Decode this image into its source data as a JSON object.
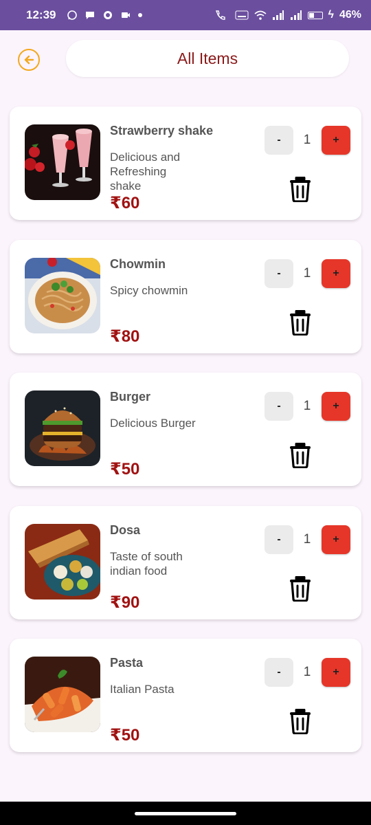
{
  "status_bar": {
    "time": "12:39",
    "battery": "46%",
    "battery_level": 0.46
  },
  "header": {
    "title": "All Items"
  },
  "items": [
    {
      "name": "Strawberry shake",
      "description": "Delicious and Refreshing shake",
      "price": "₹60",
      "quantity": "1",
      "minus_label": "-",
      "plus_label": "+"
    },
    {
      "name": "Chowmin",
      "description": "Spicy chowmin",
      "price": "₹80",
      "quantity": "1",
      "minus_label": "-",
      "plus_label": "+"
    },
    {
      "name": "Burger",
      "description": "Delicious Burger",
      "price": "₹50",
      "quantity": "1",
      "minus_label": "-",
      "plus_label": "+"
    },
    {
      "name": "Dosa",
      "description": "Taste of south indian food",
      "price": "₹90",
      "quantity": "1",
      "minus_label": "-",
      "plus_label": "+"
    },
    {
      "name": "Pasta",
      "description": "Italian Pasta",
      "price": "₹50",
      "quantity": "1",
      "minus_label": "-",
      "plus_label": "+"
    }
  ],
  "colors": {
    "status_bar": "#6b4f9e",
    "accent_back": "#f2a81d",
    "title_text": "#8b1a1a",
    "price_text": "#a11212",
    "plus_button": "#e53629"
  },
  "icons": [
    "back-arrow-icon",
    "whatsapp-icon",
    "message-icon",
    "camera-icon",
    "wifi-icon",
    "signal-icon",
    "battery-icon",
    "trash-icon"
  ]
}
